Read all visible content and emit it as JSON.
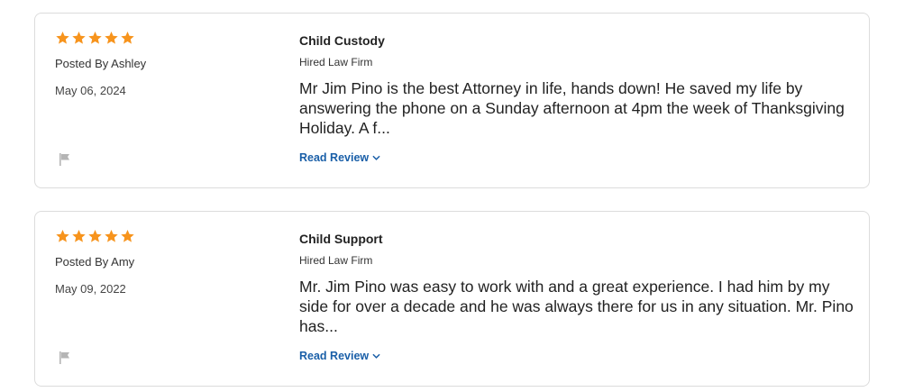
{
  "colors": {
    "star": "#f7941d",
    "link": "#1a5fa8",
    "flag": "#b5b5b5",
    "border": "#dcdcdc"
  },
  "reviews": [
    {
      "rating": 5,
      "author": "Posted By Ashley",
      "date": "May 06, 2024",
      "topic": "Child Custody",
      "status": "Hired Law Firm",
      "excerpt": "Mr Jim Pino is the best Attorney in life, hands down! He saved my life by answering the phone on a Sunday afternoon at 4pm the week of Thanksgiving Holiday. A f...",
      "read_more": "Read Review",
      "flag_icon": "flag-icon",
      "chevron_icon": "chevron-down-icon"
    },
    {
      "rating": 5,
      "author": "Posted By Amy",
      "date": "May 09, 2022",
      "topic": "Child Support",
      "status": "Hired Law Firm",
      "excerpt": "Mr. Jim Pino was easy to work with and a great experience. I had him by my side for over a decade and he was always there for us in any situation. Mr. Pino has...",
      "read_more": "Read Review",
      "flag_icon": "flag-icon",
      "chevron_icon": "chevron-down-icon"
    }
  ]
}
